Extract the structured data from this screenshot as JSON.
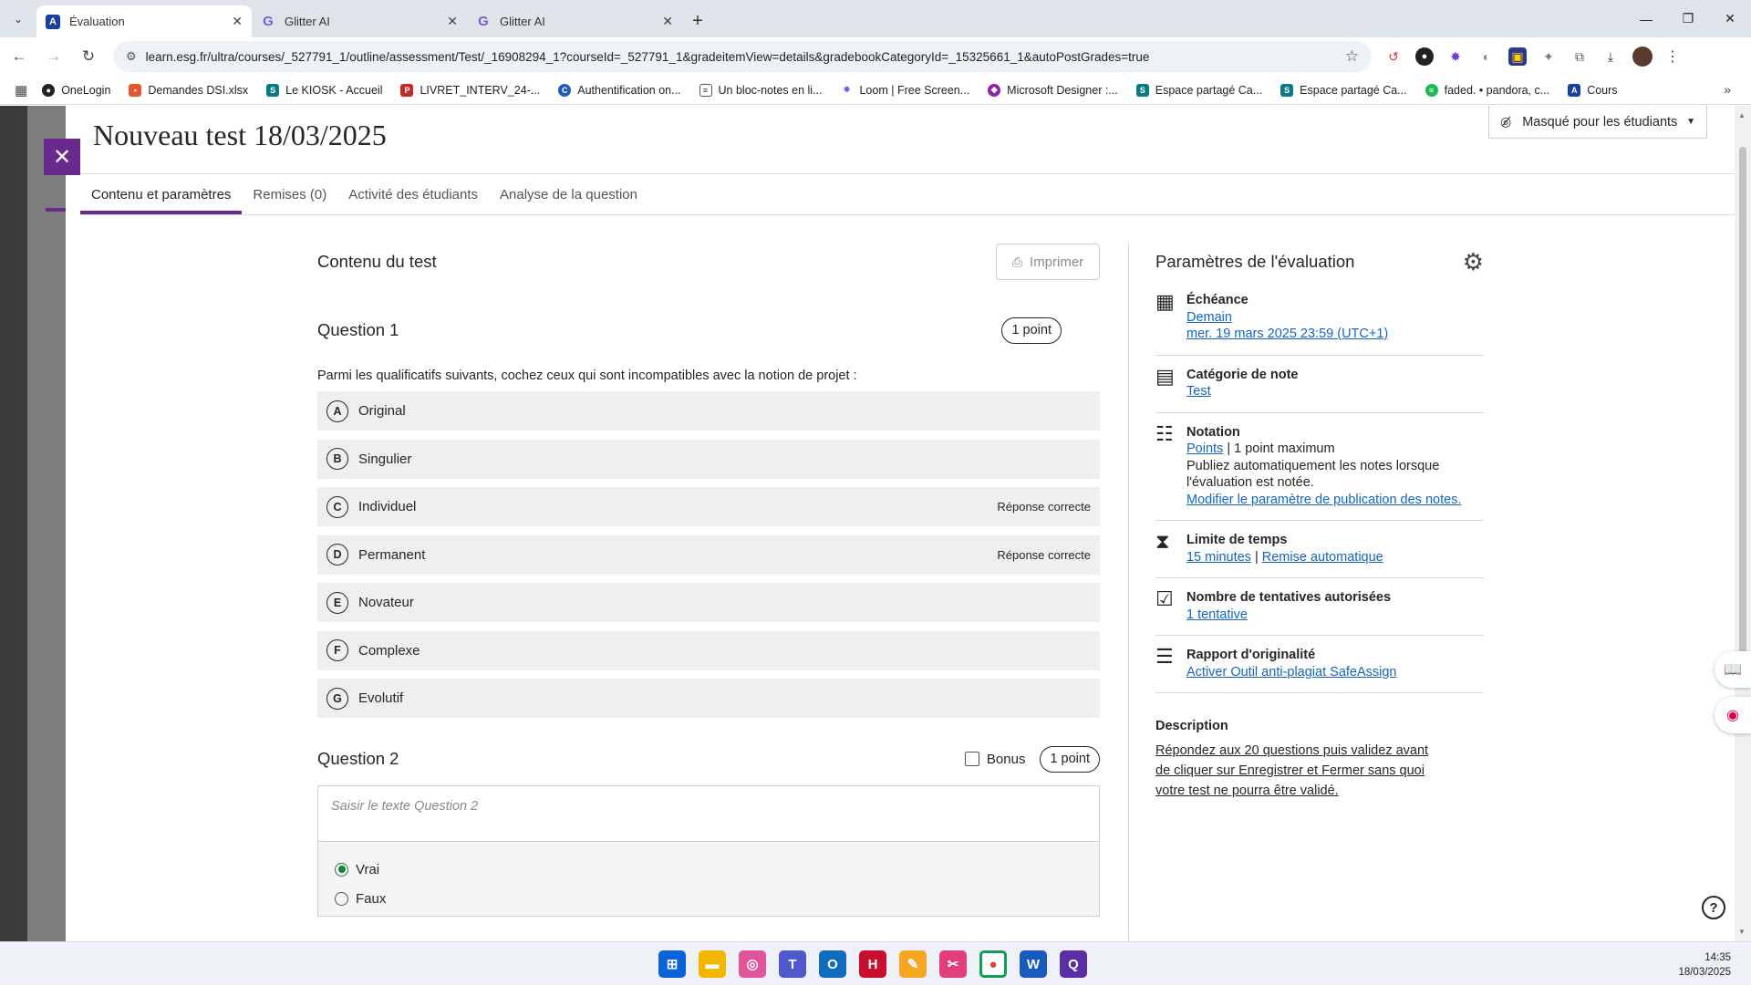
{
  "browser": {
    "tabs": [
      {
        "title": "Évaluation",
        "active": true
      },
      {
        "title": "Glitter AI",
        "active": false
      },
      {
        "title": "Glitter AI",
        "active": false
      }
    ],
    "url": "learn.esg.fr/ultra/courses/_527791_1/outline/assessment/Test/_16908294_1?courseId=_527791_1&gradeitemView=details&gradebookCategoryId=_15325661_1&autoPostGrades=true",
    "bookmarks": [
      "OneLogin",
      "Demandes DSI.xlsx",
      "Le KIOSK - Accueil",
      "LIVRET_INTERV_24-...",
      "Authentification on...",
      "Un bloc-notes en li...",
      "Loom | Free Screen...",
      "Microsoft Designer :...",
      "Espace partagé Ca...",
      "Espace partagé Ca...",
      "faded. • pandora, c...",
      "Cours"
    ]
  },
  "page": {
    "title": "Nouveau test 18/03/2025",
    "visibility": "Masqué pour les étudiants",
    "tabs": [
      "Contenu et paramètres",
      "Remises (0)",
      "Activité des étudiants",
      "Analyse de la question"
    ]
  },
  "content": {
    "heading": "Contenu du test",
    "print_label": "Imprimer",
    "q1": {
      "title": "Question 1",
      "points": "1 point",
      "text": "Parmi les qualificatifs suivants, cochez ceux qui sont incompatibles avec la notion de projet :",
      "answers": [
        {
          "letter": "A",
          "label": "Original",
          "note": ""
        },
        {
          "letter": "B",
          "label": "Singulier",
          "note": ""
        },
        {
          "letter": "C",
          "label": "Individuel",
          "note": "Réponse correcte"
        },
        {
          "letter": "D",
          "label": "Permanent",
          "note": "Réponse correcte"
        },
        {
          "letter": "E",
          "label": "Novateur",
          "note": ""
        },
        {
          "letter": "F",
          "label": "Complexe",
          "note": ""
        },
        {
          "letter": "G",
          "label": "Evolutif",
          "note": ""
        }
      ]
    },
    "q2": {
      "title": "Question 2",
      "bonus_label": "Bonus",
      "points": "1 point",
      "placeholder": "Saisir le texte Question 2",
      "options": [
        {
          "label": "Vrai",
          "selected": true
        },
        {
          "label": "Faux",
          "selected": false
        }
      ]
    }
  },
  "settings": {
    "heading": "Paramètres de l'évaluation",
    "due": {
      "title": "Échéance",
      "link1": "Demain",
      "link2": "mer. 19 mars 2025 23:59 (UTC+1)"
    },
    "category": {
      "title": "Catégorie de note",
      "link": "Test"
    },
    "grading": {
      "title": "Notation",
      "link": "Points",
      "max": " | 1 point maximum",
      "text": "Publiez automatiquement les notes lorsque l'évaluation est notée.",
      "link2": "Modifier le paramètre de publication des notes."
    },
    "time": {
      "title": "Limite de temps",
      "link1": "15 minutes",
      "sep": " | ",
      "link2": "Remise automatique"
    },
    "attempts": {
      "title": "Nombre de tentatives autorisées",
      "link": "1 tentative"
    },
    "originality": {
      "title": "Rapport d'originalité",
      "link": "Activer Outil anti-plagiat SafeAssign"
    },
    "description": {
      "title": "Description",
      "text": "Répondez aux 20 questions puis validez avant de cliquer sur Enregistrer et Fermer sans quoi votre test ne pourra être validé."
    }
  },
  "clock": {
    "time": "14:35",
    "date": "18/03/2025"
  },
  "colors": {
    "accent": "#6a2a8c",
    "link": "#1565c0",
    "selected_radio": "#1e7e3b"
  }
}
